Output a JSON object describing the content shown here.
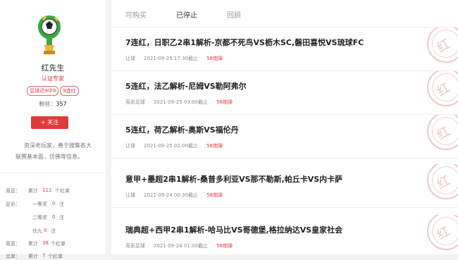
{
  "profile": {
    "name": "红先生",
    "certified": "认证专家",
    "tags": [
      "足球近9中9",
      "9连红"
    ],
    "fans_label": "粉丝：",
    "fans_count": "357",
    "follow_button": "+ 关注",
    "bio": "资深老玩家，善于搜集各大联赛基本面，仿佛等信息。"
  },
  "stats": [
    {
      "label": "竞足：",
      "prefix": "累计",
      "value": "111",
      "suffix": "个红单"
    },
    {
      "label": "足彩：",
      "prefix": "一等奖",
      "value": "0",
      "suffix": "注"
    },
    {
      "label": "",
      "prefix": "二等奖",
      "value": "0",
      "suffix": "注"
    },
    {
      "label": "",
      "prefix": "任九",
      "value": "0",
      "suffix": "注"
    },
    {
      "label": "竞篮：",
      "prefix": "累计",
      "value": "38",
      "suffix": "个红单"
    },
    {
      "label": "北单：",
      "prefix": "累计",
      "value": "7",
      "suffix": "个红单"
    }
  ],
  "tabs": [
    "可购买",
    "已停止",
    "回顾"
  ],
  "active_tab": "已停止",
  "items": [
    {
      "title": "7连红，日职乙2串1解析-京都不死鸟VS枥木SC,磐田喜悦VS琉球FC",
      "category": "让球",
      "time": "2021-09-25 17:30截止",
      "price": "58炮弹",
      "stamp": "红"
    },
    {
      "title": "5连红，法乙解析-尼姆VS勒阿弗尔",
      "category": "竞彩足球",
      "time": "2021-09-25 03:00截止",
      "price": "58炮弹",
      "stamp": "红"
    },
    {
      "title": "5连红，荷乙解析-奥斯VS福伦丹",
      "category": "让球",
      "time": "2021-09-25 02:00截止",
      "price": "58炮弹",
      "stamp": "红"
    },
    {
      "title": "意甲+墨超2串1解析-桑普多利亚VS那不勒斯,帕丘卡VS内卡萨",
      "category": "让球",
      "time": "2021-09-24 00:30截止",
      "price": "58炮弹",
      "stamp": "红"
    },
    {
      "title": "瑞典超+西甲2串1解析-哈马比VS哥德堡,格拉纳达VS皇家社会",
      "category": "竞彩足球",
      "time": "2021-09-24 01:00截止",
      "price": "58炮弹",
      "stamp": "红"
    }
  ],
  "colors": {
    "accent": "#e03a3a",
    "background": "#f3f3f3"
  }
}
